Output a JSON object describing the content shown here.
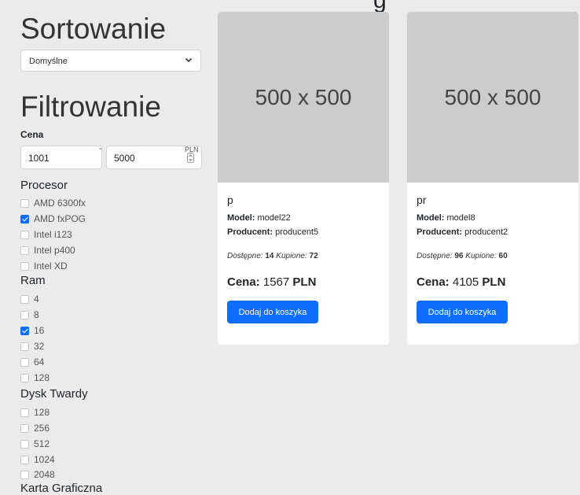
{
  "top_heading": "g",
  "sidebar": {
    "sort_title": "Sortowanie",
    "sort_selected": "Domyślne",
    "filter_title": "Filtrowanie",
    "price": {
      "label": "Cena",
      "min": "1001",
      "separator": "-",
      "max": "5000",
      "currency": "PLN"
    },
    "groups": [
      {
        "title": "Procesor",
        "options": [
          {
            "label": "AMD 6300fx",
            "checked": false
          },
          {
            "label": "AMD fxPOG",
            "checked": true
          },
          {
            "label": "Intel i123",
            "checked": false
          },
          {
            "label": "Intel p400",
            "checked": false
          },
          {
            "label": "Intel XD",
            "checked": false
          }
        ]
      },
      {
        "title": "Ram",
        "options": [
          {
            "label": "4",
            "checked": false
          },
          {
            "label": "8",
            "checked": false
          },
          {
            "label": "16",
            "checked": true
          },
          {
            "label": "32",
            "checked": false
          },
          {
            "label": "64",
            "checked": false
          },
          {
            "label": "128",
            "checked": false
          }
        ]
      },
      {
        "title": "Dysk Twardy",
        "options": [
          {
            "label": "128",
            "checked": false
          },
          {
            "label": "256",
            "checked": false
          },
          {
            "label": "512",
            "checked": false
          },
          {
            "label": "1024",
            "checked": false
          },
          {
            "label": "2048",
            "checked": false
          }
        ]
      }
    ],
    "next_group_cut": "Karta Graficzna"
  },
  "products": [
    {
      "image_text": "500 x 500",
      "name": "p",
      "model_label": "Model:",
      "model": "model22",
      "producer_label": "Producent:",
      "producer": "producent5",
      "available_label": "Dostępne:",
      "available": "14",
      "bought_label": "Kupione:",
      "bought": "72",
      "price_label": "Cena:",
      "price": "1567",
      "currency": "PLN",
      "button": "Dodaj do koszyka"
    },
    {
      "image_text": "500 x 500",
      "name": "pr",
      "model_label": "Model:",
      "model": "model8",
      "producer_label": "Producent:",
      "producer": "producent2",
      "available_label": "Dostępne:",
      "available": "96",
      "bought_label": "Kupione:",
      "bought": "60",
      "price_label": "Cena:",
      "price": "4105",
      "currency": "PLN",
      "button": "Dodaj do koszyka"
    }
  ],
  "colors": {
    "accent": "#0d6efd",
    "background": "#ebebeb",
    "placeholder": "#cccccc"
  }
}
